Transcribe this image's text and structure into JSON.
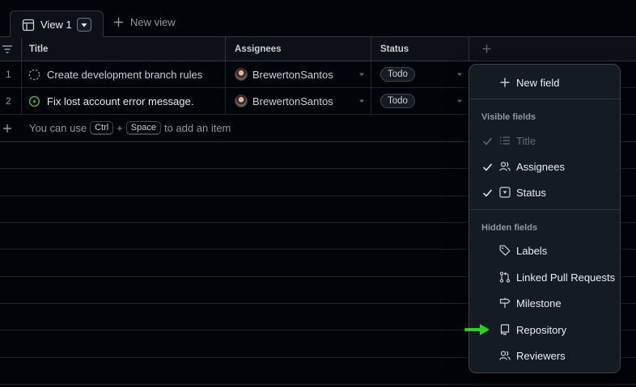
{
  "tabs": {
    "active_label": "View 1",
    "new_view_label": "New view"
  },
  "table": {
    "columns": [
      "Title",
      "Assignees",
      "Status"
    ],
    "rows": [
      {
        "num": "1",
        "title": "Create development branch rules",
        "assignee": "BrewertonSantos",
        "status": "Todo",
        "status_icon": "draft-circle-icon"
      },
      {
        "num": "2",
        "title": "Fix lost account error message.",
        "assignee": "BrewertonSantos",
        "status": "Todo",
        "status_icon": "open-issue-icon"
      }
    ],
    "add_item": {
      "prefix": "You can use",
      "key1": "Ctrl",
      "plus": "+",
      "key2": "Space",
      "suffix": "to add an item"
    }
  },
  "menu": {
    "new_field_label": "New field",
    "visible_heading": "Visible fields",
    "visible_fields": [
      {
        "label": "Title",
        "checked": true,
        "disabled": true,
        "icon": "list-icon"
      },
      {
        "label": "Assignees",
        "checked": true,
        "disabled": false,
        "icon": "people-icon"
      },
      {
        "label": "Status",
        "checked": true,
        "disabled": false,
        "icon": "single-select-icon"
      }
    ],
    "hidden_heading": "Hidden fields",
    "hidden_fields": [
      {
        "label": "Labels",
        "icon": "tag-icon"
      },
      {
        "label": "Linked Pull Requests",
        "icon": "pull-request-icon"
      },
      {
        "label": "Milestone",
        "icon": "milestone-icon"
      },
      {
        "label": "Repository",
        "icon": "repo-icon"
      },
      {
        "label": "Reviewers",
        "icon": "people-icon"
      }
    ]
  },
  "colors": {
    "background": "#010409",
    "accent_arrow": "#2bd31e",
    "border": "#30363d",
    "open_issue_green": "#3fb950"
  }
}
